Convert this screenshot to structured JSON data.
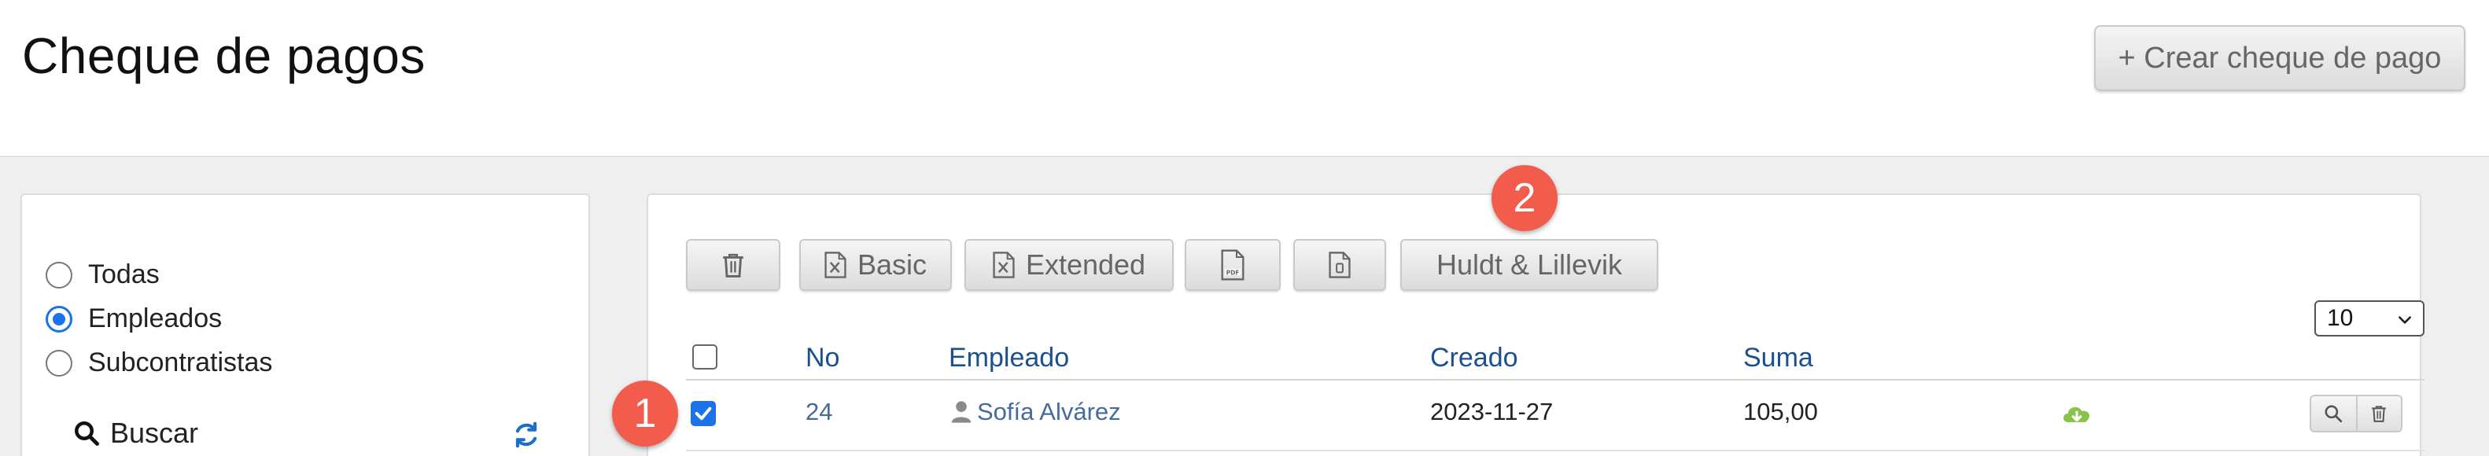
{
  "header": {
    "title": "Cheque de pagos",
    "create_button": "+ Crear cheque de pago"
  },
  "filters": {
    "options": [
      {
        "label": "Todas",
        "checked": false
      },
      {
        "label": "Empleados",
        "checked": true
      },
      {
        "label": "Subcontratistas",
        "checked": false
      }
    ],
    "search_label": "Buscar"
  },
  "toolbar": {
    "delete_icon": "trash-icon",
    "basic_label": "Basic",
    "extended_label": "Extended",
    "pdf_icon": "pdf-file-icon",
    "file_icon": "file-icon",
    "company_label": "Huldt & Lillevik"
  },
  "page_size": "10",
  "table": {
    "columns": [
      "No",
      "Empleado",
      "Creado",
      "Suma"
    ],
    "rows": [
      {
        "no": "24",
        "employee": "Sofía Alvárez",
        "created": "2023-11-27",
        "sum": "105,00",
        "checked": true
      }
    ]
  },
  "badges": [
    "1",
    "2"
  ],
  "colors": {
    "accent": "#1a73e8",
    "link": "#1b4f8e",
    "badge": "#f25c4c",
    "download": "#8bc34a"
  }
}
